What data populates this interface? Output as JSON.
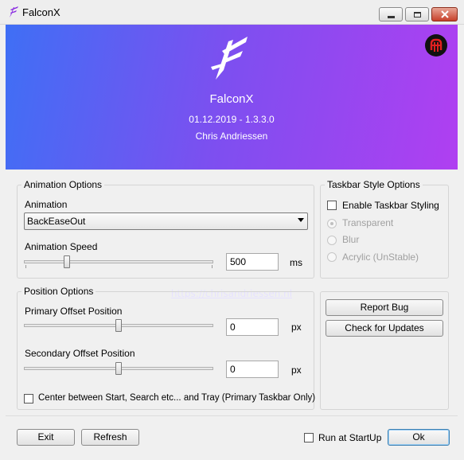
{
  "window": {
    "title": "FalconX"
  },
  "banner": {
    "app_name": "FalconX",
    "version": "01.12.2019 - 1.3.3.0",
    "author": "Chris Andriessen",
    "website": "https://chrisandriessen.nl"
  },
  "animation_options": {
    "title": "Animation Options",
    "animation_label": "Animation",
    "animation_value": "BackEaseOut",
    "speed_label": "Animation Speed",
    "speed_value": "500",
    "speed_unit": "ms"
  },
  "taskbar_style": {
    "title": "Taskbar Style Options",
    "enable_label": "Enable Taskbar Styling",
    "options": [
      "Transparent",
      "Blur",
      "Acrylic (UnStable)"
    ],
    "selected": "Transparent"
  },
  "position_options": {
    "title": "Position Options",
    "primary_label": "Primary Offset Position",
    "primary_value": "0",
    "primary_unit": "px",
    "secondary_label": "Secondary Offset Position",
    "secondary_value": "0",
    "secondary_unit": "px",
    "center_label": "Center between Start, Search etc... and Tray (Primary Taskbar Only)"
  },
  "actions": {
    "report_bug": "Report Bug",
    "check_updates": "Check for Updates"
  },
  "footer": {
    "exit": "Exit",
    "refresh": "Refresh",
    "run_at_startup": "Run at StartUp",
    "ok": "Ok"
  },
  "colors": {
    "banner_start": "#3f6ff5",
    "banner_end": "#b03ff1"
  },
  "icons": {
    "app": "falcon-logo-icon",
    "badge": "author-badge-icon"
  }
}
